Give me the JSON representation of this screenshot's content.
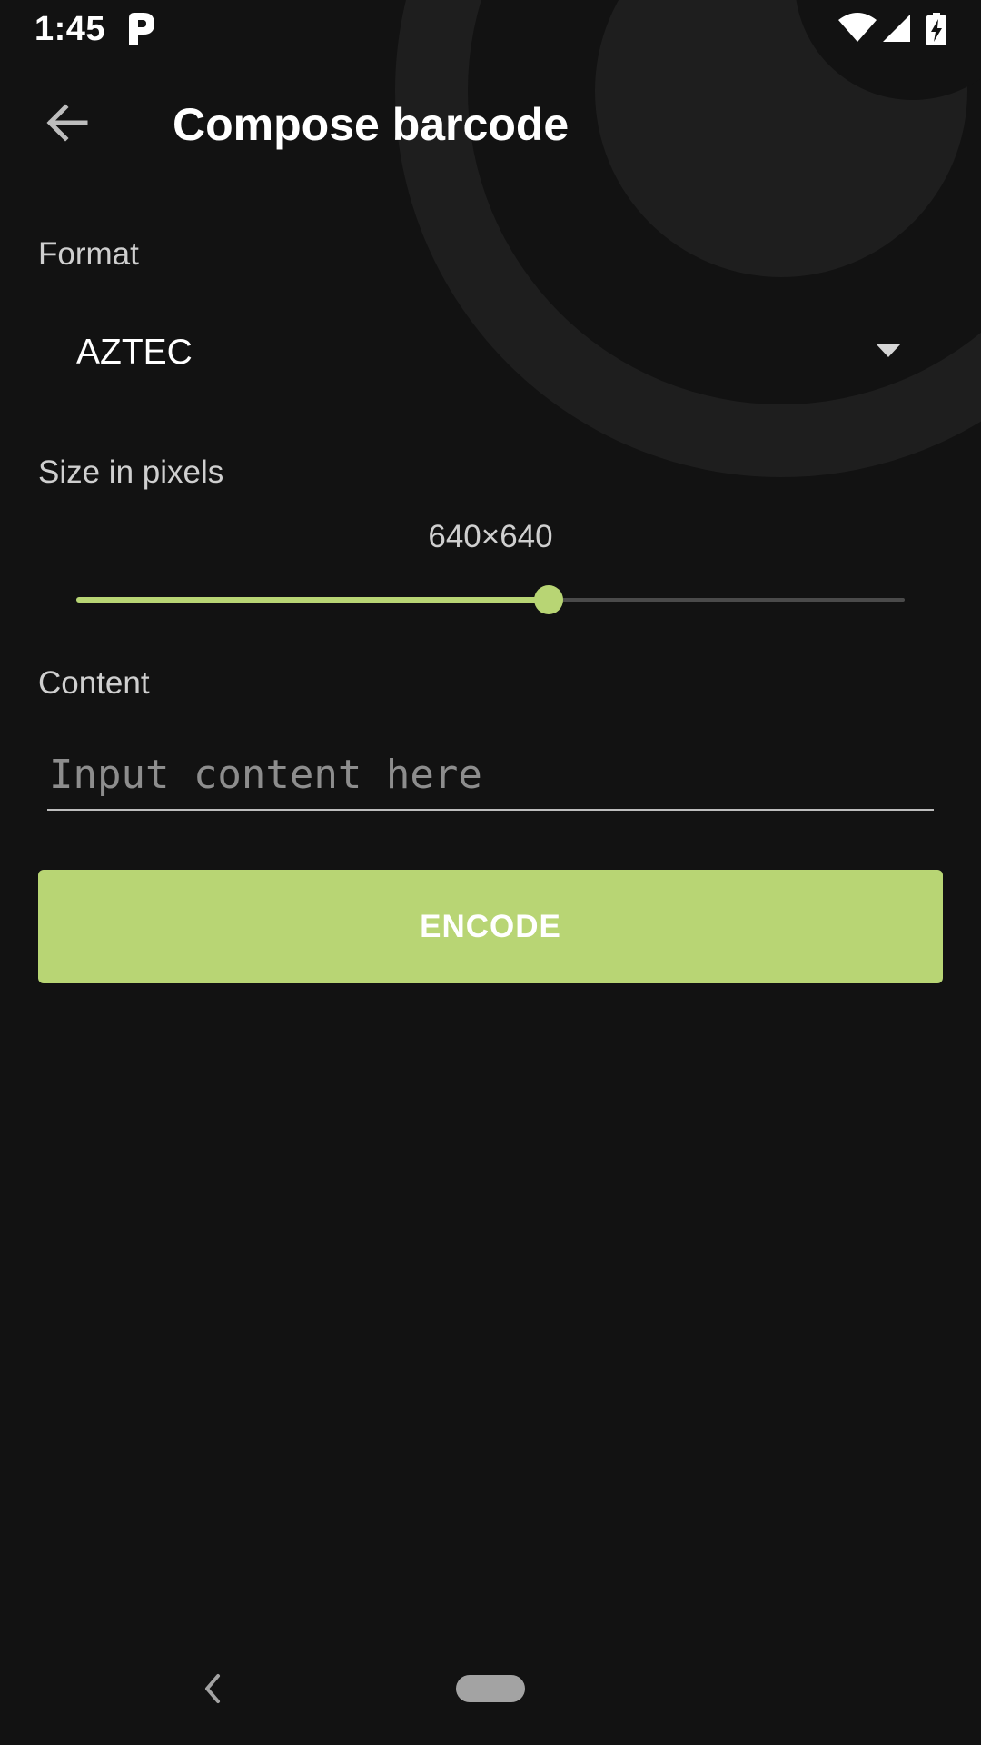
{
  "status_bar": {
    "time": "1:45",
    "icons": [
      "p-app-icon",
      "wifi-icon",
      "signal-icon",
      "battery-charging-icon"
    ]
  },
  "toolbar": {
    "title": "Compose barcode",
    "back_icon": "arrow-back-icon"
  },
  "format": {
    "label": "Format",
    "selected": "AZTEC",
    "icon": "dropdown-arrow-icon"
  },
  "size": {
    "label": "Size in pixels",
    "value_text": "640×640",
    "slider_fraction": 0.57
  },
  "content": {
    "label": "Content",
    "placeholder": "Input content here",
    "value": ""
  },
  "actions": {
    "encode_label": "ENCODE"
  },
  "nav_bar": {
    "icons": [
      "nav-back-icon",
      "nav-home-pill"
    ]
  },
  "colors": {
    "background": "#121212",
    "accent": "#b8d574",
    "decor_ring": "#1e1e1e",
    "text_secondary": "#cfcfcf"
  }
}
